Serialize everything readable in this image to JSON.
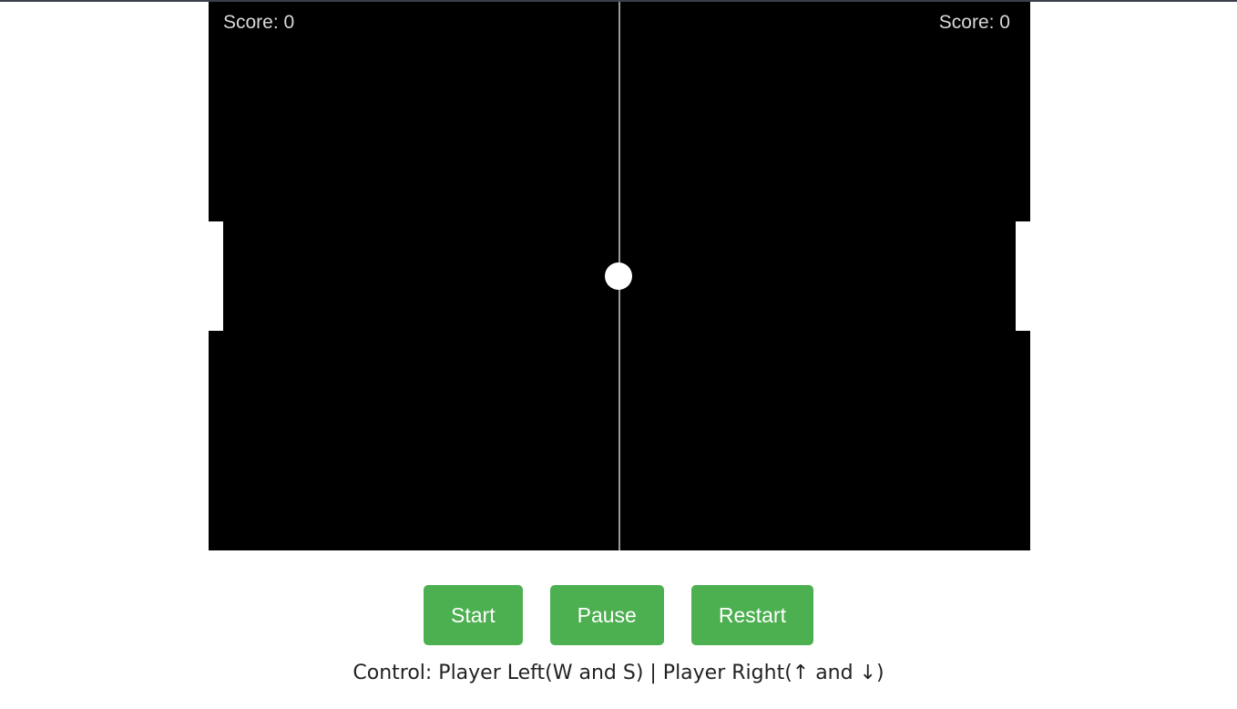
{
  "scoreboard": {
    "left_label": "Score: 0",
    "right_label": "Score: 0",
    "left_score": 0,
    "right_score": 0
  },
  "buttons": {
    "start": "Start",
    "pause": "Pause",
    "restart": "Restart"
  },
  "instructions": "Control: Player Left(W and S) | Player Right(↑ and ↓)",
  "colors": {
    "canvas_bg": "#000000",
    "button_bg": "#4caf50",
    "paddle": "#ffffff",
    "ball": "#ffffff",
    "center_line": "#9a9a9a"
  }
}
